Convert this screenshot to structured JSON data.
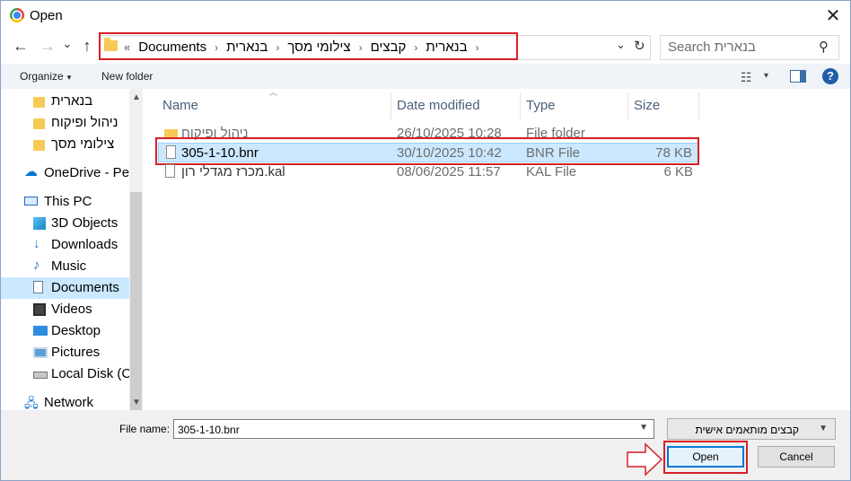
{
  "window": {
    "title": "Open",
    "close_symbol": "✕"
  },
  "nav": {
    "back": "←",
    "forward": "→",
    "recent": "⌄",
    "up": "↑"
  },
  "address": {
    "overflow": "«",
    "crumbs": [
      "Documents",
      "בנארית",
      "צילומי מסך",
      "קבצים",
      "בנארית"
    ],
    "separator": "›",
    "dropdown": "⌄",
    "refresh": "↻"
  },
  "search": {
    "placeholder": "Search בנארית",
    "icon": "search-icon"
  },
  "toolbar": {
    "organize": "Organize",
    "new_folder": "New folder",
    "dropdown": "▾",
    "help": "?"
  },
  "sidebar": {
    "items": [
      {
        "label": "בנארית",
        "icon": "folder-icon"
      },
      {
        "label": "ניהול ופיקוח",
        "icon": "folder-icon"
      },
      {
        "label": "צילומי מסך",
        "icon": "folder-icon"
      },
      {
        "label": "OneDrive - Pe",
        "icon": "onedrive-icon"
      },
      {
        "label": "This PC",
        "icon": "computer-icon"
      },
      {
        "label": "3D Objects",
        "icon": "3d-objects-icon"
      },
      {
        "label": "Downloads",
        "icon": "downloads-icon"
      },
      {
        "label": "Music",
        "icon": "music-icon"
      },
      {
        "label": "Documents",
        "icon": "documents-icon",
        "selected": true
      },
      {
        "label": "Videos",
        "icon": "videos-icon"
      },
      {
        "label": "Desktop",
        "icon": "desktop-icon"
      },
      {
        "label": "Pictures",
        "icon": "pictures-icon"
      },
      {
        "label": "Local Disk (C",
        "icon": "disk-icon"
      },
      {
        "label": "Network",
        "icon": "network-icon"
      }
    ]
  },
  "columns": {
    "name": "Name",
    "date": "Date modified",
    "type": "Type",
    "size": "Size"
  },
  "files": [
    {
      "name": "ניהול ופיקוח",
      "date": "26/10/2025 10:28",
      "type": "File folder",
      "size": "",
      "icon": "folder-icon"
    },
    {
      "name": "305-1-10.bnr",
      "date": "30/10/2025 10:42",
      "type": "BNR File",
      "size": "78 KB",
      "icon": "file-icon",
      "selected": true
    },
    {
      "name": "מכרז מגדלי רון.kal",
      "date": "08/06/2025 11:57",
      "type": "KAL File",
      "size": "6 KB",
      "icon": "file-icon"
    }
  ],
  "footer": {
    "file_name_label": "File name:",
    "file_name_value": "305-1-10.bnr",
    "filter_value": "קבצים מותאמים אישית",
    "open_label": "Open",
    "cancel_label": "Cancel"
  },
  "annotation_color": "#d81f26",
  "selection_color": "#cce8ff"
}
